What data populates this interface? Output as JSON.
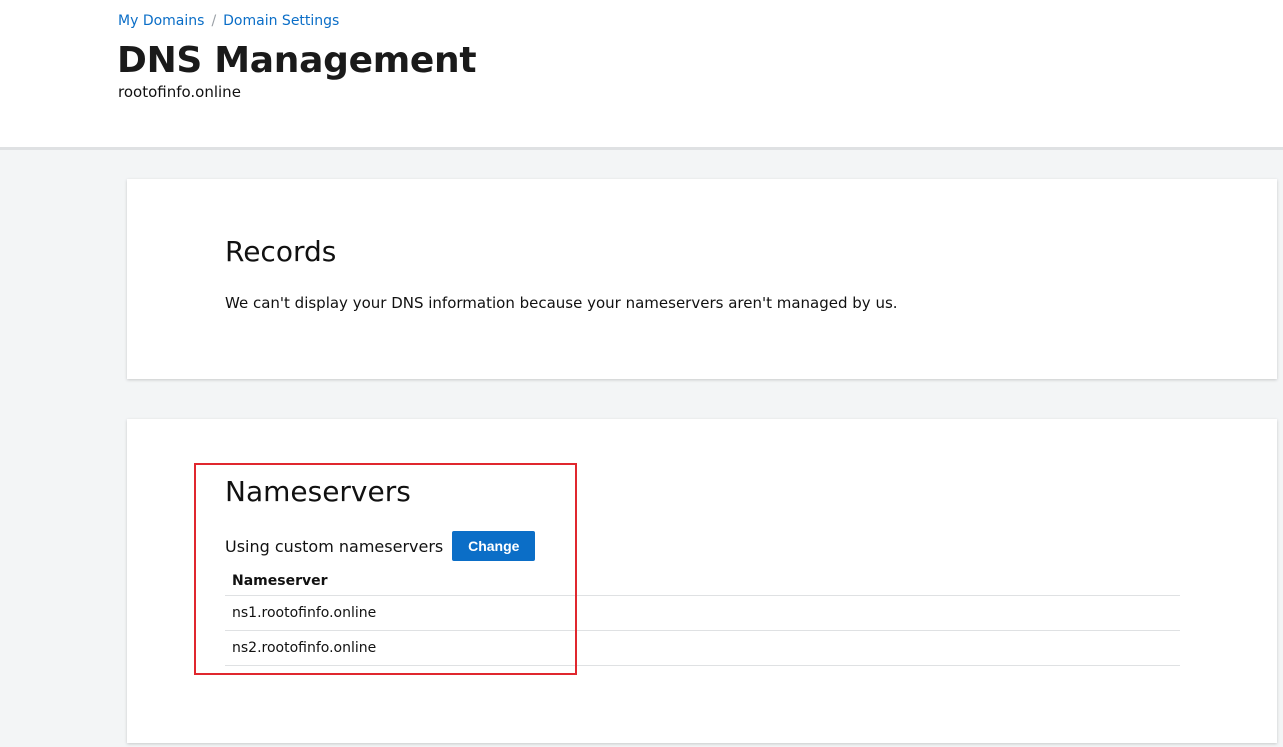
{
  "breadcrumb": {
    "items": [
      {
        "label": "My Domains"
      },
      {
        "label": "Domain Settings"
      }
    ],
    "separator": "/"
  },
  "header": {
    "title": "DNS Management",
    "domain": "rootofinfo.online"
  },
  "records": {
    "title": "Records",
    "message": "We can't display your DNS information because your nameservers aren't managed by us."
  },
  "nameservers": {
    "title": "Nameservers",
    "status": "Using custom nameservers",
    "change_label": "Change",
    "column_header": "Nameserver",
    "rows": [
      "ns1.rootofinfo.online",
      "ns2.rootofinfo.online"
    ]
  },
  "colors": {
    "link": "#0b6ec7",
    "button": "#0b6ec7",
    "highlight": "#e0272e"
  }
}
